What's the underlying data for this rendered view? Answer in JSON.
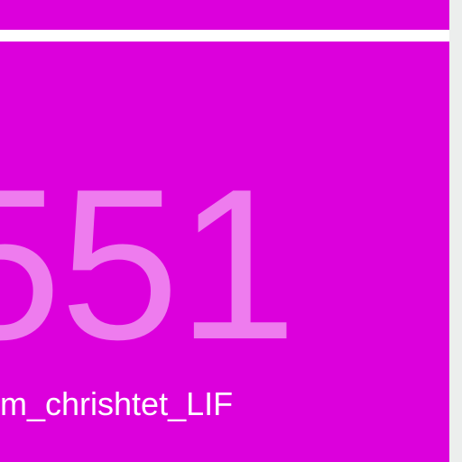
{
  "tiles": {
    "main": {
      "number": "551",
      "label": "m_chrishtet_LIF"
    }
  },
  "colors": {
    "tile_background": "#dc00dc",
    "number_color": "#ee7cee",
    "label_color": "#ffffff",
    "edge_color": "#eceeed",
    "page_background": "#ffffff"
  }
}
